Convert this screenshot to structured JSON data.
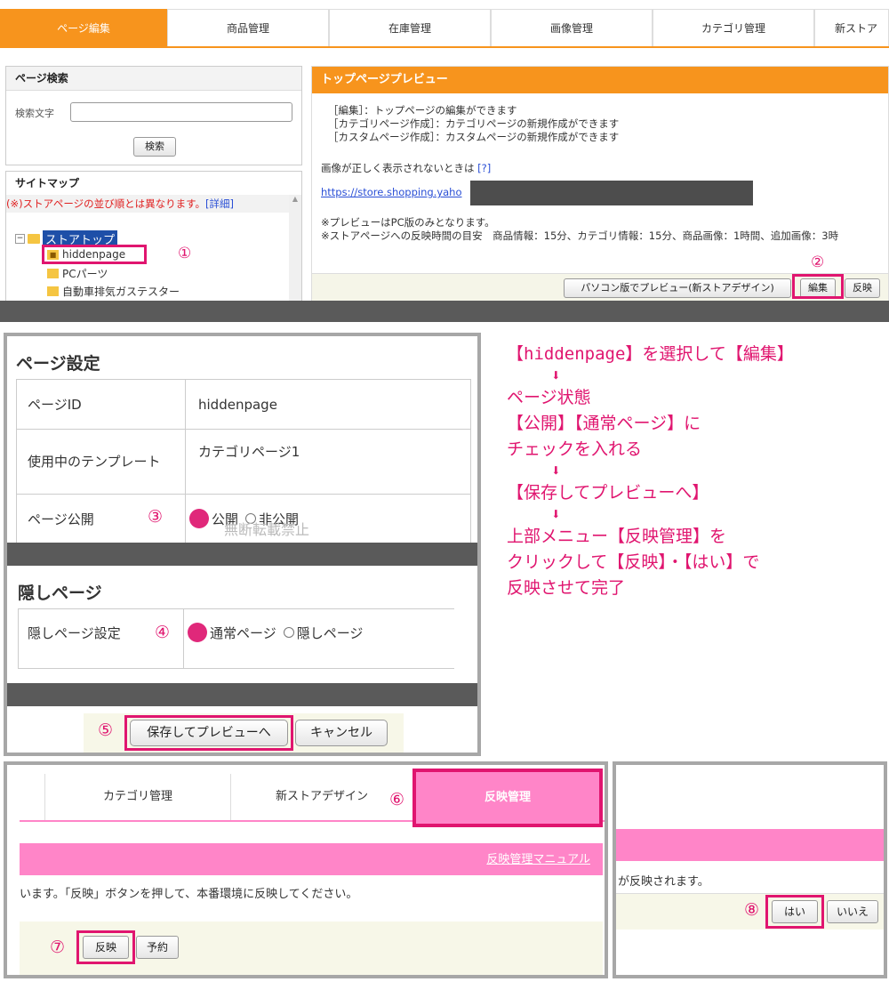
{
  "nav": {
    "tabs": [
      "ページ編集",
      "商品管理",
      "在庫管理",
      "画像管理",
      "カテゴリ管理",
      "新ストア"
    ]
  },
  "search": {
    "title": "ページ検索",
    "label": "検索文字",
    "input_value": "",
    "button": "検索"
  },
  "sitemap": {
    "title": "サイトマップ",
    "notice": "(※)ストアページの並び順とは異なります。",
    "notice_link": "[詳細]",
    "tree": {
      "root": "ストアトップ",
      "items": [
        "hiddenpage",
        "PCパーツ",
        "自動車排気ガステスター"
      ]
    }
  },
  "preview": {
    "title": "トップページプレビュー",
    "desc1": "［編集］：トップページの編集ができます",
    "desc2": "［カテゴリページ作成］：カテゴリページの新規作成ができます",
    "desc3": "［カスタムページ作成］：カスタムページの新規作成ができます",
    "image_notice": "画像が正しく表示されないときは",
    "help_link": "[?]",
    "url": "https://store.shopping.yaho",
    "pc_only": "※プレビューはPC版のみとなります。",
    "timing": "※ストアページへの反映時間の目安　商品情報：15分、カテゴリ情報：15分、商品画像：1時間、追加画像：3時",
    "btn_preview": "パソコン版でプレビュー(新ストアデザイン)",
    "btn_edit": "編集",
    "btn_reflect": "反映"
  },
  "page_settings": {
    "title": "ページ設定",
    "rows": [
      {
        "key": "ページID",
        "value": "hiddenpage"
      },
      {
        "key": "使用中のテンプレート",
        "value": "カテゴリページ1"
      },
      {
        "key": "ページ公開",
        "value": ""
      }
    ],
    "public": "公開",
    "private": "非公開",
    "watermark": "無断転載禁止"
  },
  "hidden_page": {
    "title": "隠しページ",
    "key": "隠しページ設定",
    "normal": "通常ページ",
    "hidden": "隠しページ"
  },
  "save": {
    "save_button": "保存してプレビューへ",
    "cancel_button": "キャンセル"
  },
  "instructions": {
    "line1": "【hiddenpage】を選択して【編集】",
    "line2": "ページ状態",
    "line3": "【公開】【通常ページ】に",
    "line4": "チェックを入れる",
    "line5": "【保存してプレビューへ】",
    "line6": "上部メニュー【反映管理】を",
    "line7": "クリックして【反映】・【はい】で",
    "line8": "反映させて完了"
  },
  "reflect": {
    "tab_category": "カテゴリ管理",
    "tab_newstore": "新ストアデザイン",
    "tab_reflect": "反映管理",
    "manual_link": "反映管理マニュアル",
    "message": "います。「反映」ボタンを押して、本番環境に反映してください。",
    "btn_reflect": "反映",
    "btn_reserve": "予約"
  },
  "confirm": {
    "message": "が反映されます。",
    "yes": "はい",
    "no": "いいえ"
  },
  "steps": [
    "①",
    "②",
    "③",
    "④",
    "⑤",
    "⑥",
    "⑦",
    "⑧"
  ],
  "colors": {
    "orange": "#f7941d",
    "pink": "#ff85c8",
    "highlight": "#e0156f"
  }
}
